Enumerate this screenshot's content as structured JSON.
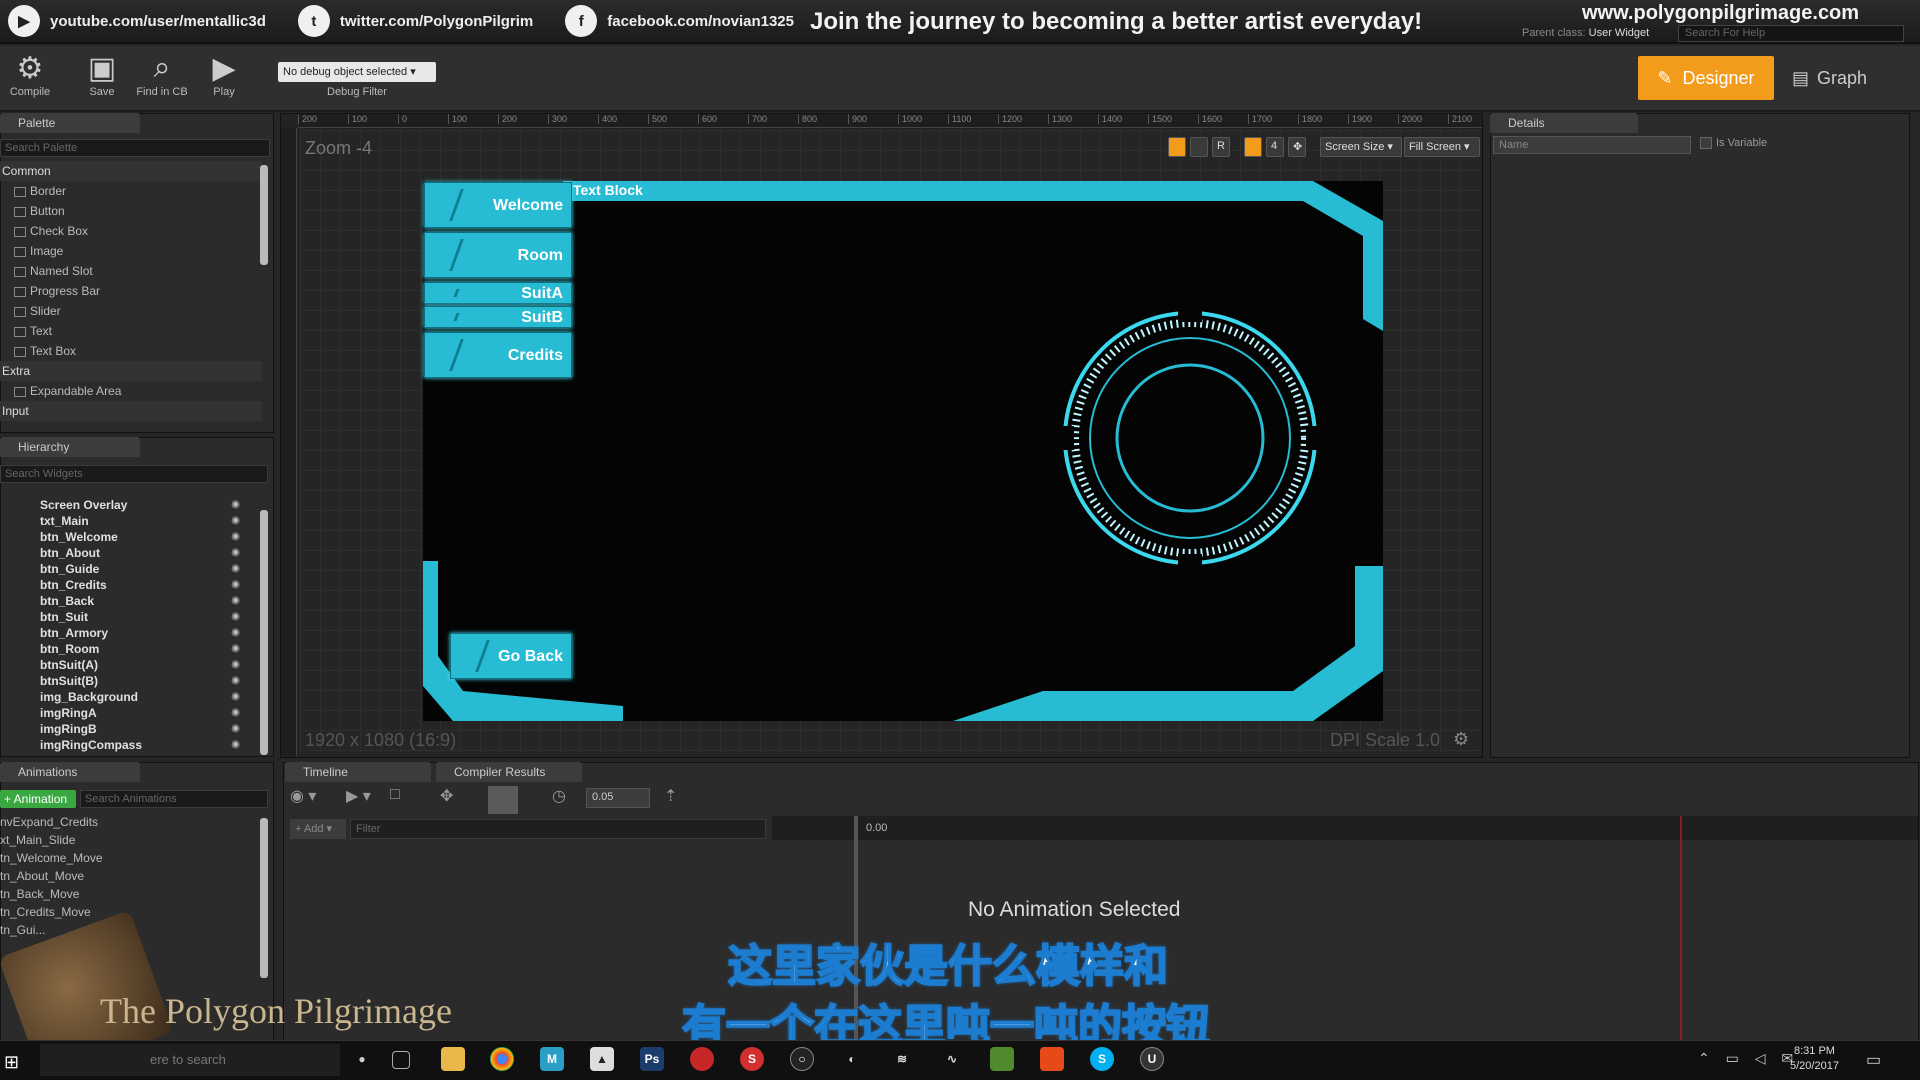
{
  "banner": {
    "youtube": "youtube.com/user/mentallic3d",
    "twitter": "twitter.com/PolygonPilgrim",
    "facebook": "facebook.com/novian1325",
    "slogan": "Join the journey to becoming a better artist everyday!",
    "site": "www.polygonpilgrimage.com",
    "parent_label": "Parent class:",
    "parent_value": "User Widget",
    "help_placeholder": "Search For Help"
  },
  "toolbar": {
    "compile": "Compile",
    "save": "Save",
    "find": "Find in CB",
    "play": "Play",
    "debug_select": "No debug object selected ▾",
    "debug_filter": "Debug Filter",
    "designer": "Designer",
    "graph": "Graph"
  },
  "palette": {
    "tab": "Palette",
    "search_placeholder": "Search Palette",
    "groups": [
      {
        "name": "Common",
        "items": [
          "Border",
          "Button",
          "Check Box",
          "Image",
          "Named Slot",
          "Progress Bar",
          "Slider",
          "Text",
          "Text Box"
        ]
      },
      {
        "name": "Extra",
        "items": [
          "Expandable Area"
        ]
      },
      {
        "name": "Input",
        "items": []
      }
    ]
  },
  "hierarchy": {
    "tab": "Hierarchy",
    "search_placeholder": "Search Widgets",
    "items": [
      "Screen Overlay",
      "txt_Main",
      "btn_Welcome",
      "btn_About",
      "btn_Guide",
      "btn_Credits",
      "btn_Back",
      "btn_Suit",
      "btn_Armory",
      "btn_Room",
      "btnSuit(A)",
      "btnSuit(B)",
      "img_Background",
      "imgRingA",
      "imgRingB",
      "imgRingCompass"
    ]
  },
  "animations": {
    "tab": "Animations",
    "add_button": "+ Animation",
    "search_placeholder": "Search Animations",
    "items": [
      "nvExpand_Credits",
      "xt_Main_Slide",
      "tn_Welcome_Move",
      "tn_About_Move",
      "tn_Back_Move",
      "tn_Credits_Move",
      "tn_Gui..."
    ]
  },
  "designer": {
    "zoom": "Zoom -4",
    "screen_info": "1920 x 1080 (16:9)",
    "dpi": "DPI Scale 1.0",
    "screen_size": "Screen Size ▾",
    "fill_screen": "Fill Screen ▾",
    "text_block": "Text Block",
    "ruler": [
      "200",
      "100",
      "0",
      "100",
      "200",
      "300",
      "400",
      "500",
      "600",
      "700",
      "800",
      "900",
      "1000",
      "1100",
      "1200",
      "1300",
      "1400",
      "1500",
      "1600",
      "1700",
      "1800",
      "1900",
      "2000",
      "2100"
    ],
    "buttons": [
      "Welcome",
      "Room",
      "SuitA",
      "SuitB",
      "Credits"
    ],
    "go_back": "Go Back",
    "accent": "#27bcd4"
  },
  "details": {
    "tab": "Details",
    "name_placeholder": "Name",
    "is_variable": "Is Variable"
  },
  "timeline": {
    "tab_timeline": "Timeline",
    "tab_compiler": "Compiler Results",
    "add": "+ Add ▾",
    "filter_placeholder": "Filter",
    "snap": "0.05",
    "time_start": "0.00",
    "no_animation": "No Animation Selected"
  },
  "subtitles": {
    "line1": "这里家伙是什么模样和",
    "line2": "有一个在这里吨一吨的按钮"
  },
  "watermark": "The Polygon Pilgrimage",
  "taskbar": {
    "search_placeholder": "ere to search",
    "time": "8:31 PM",
    "date": "5/20/2017"
  }
}
